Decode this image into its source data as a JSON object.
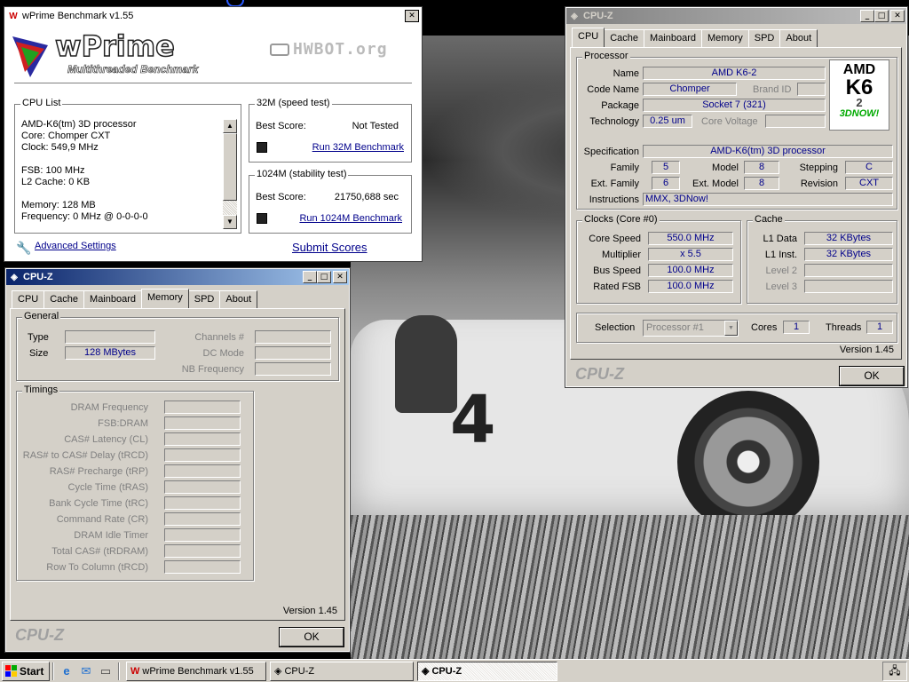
{
  "wprime": {
    "title": "wPrime Benchmark v1.55",
    "logo_text": "wPrime",
    "logo_sub": "Multithreaded Benchmark",
    "hwbot": "HWBOT.org",
    "cpu_list_label": "CPU List",
    "cpu_lines": [
      "AMD-K6(tm) 3D processor",
      "Core: Chomper CXT",
      "Clock: 549,9 MHz",
      "",
      "FSB: 100 MHz",
      "L2 Cache: 0 KB",
      "",
      "Memory: 128 MB",
      "Frequency: 0 MHz @ 0-0-0-0"
    ],
    "test32_label": "32M (speed test)",
    "best_score_label": "Best Score:",
    "score32": "Not Tested",
    "run32": "Run 32M Benchmark",
    "test1024_label": "1024M (stability test)",
    "score1024": "21750,688 sec",
    "run1024": "Run 1024M Benchmark",
    "advanced": "Advanced Settings",
    "submit": "Submit Scores"
  },
  "cpuz_mem": {
    "title": "CPU-Z",
    "tabs": [
      "CPU",
      "Cache",
      "Mainboard",
      "Memory",
      "SPD",
      "About"
    ],
    "selected_tab": "Memory",
    "general_label": "General",
    "type_label": "Type",
    "type_value": "",
    "size_label": "Size",
    "size_value": "128 MBytes",
    "channels_label": "Channels #",
    "dcmode_label": "DC Mode",
    "nbfreq_label": "NB Frequency",
    "timings_label": "Timings",
    "timings": [
      "DRAM Frequency",
      "FSB:DRAM",
      "CAS# Latency (CL)",
      "RAS# to CAS# Delay (tRCD)",
      "RAS# Precharge (tRP)",
      "Cycle Time (tRAS)",
      "Bank Cycle Time (tRC)",
      "Command Rate (CR)",
      "DRAM Idle Timer",
      "Total CAS# (tRDRAM)",
      "Row To Column (tRCD)"
    ],
    "version": "Version 1.45",
    "brand": "CPU-Z",
    "ok": "OK"
  },
  "cpuz_cpu": {
    "title": "CPU-Z",
    "tabs": [
      "CPU",
      "Cache",
      "Mainboard",
      "Memory",
      "SPD",
      "About"
    ],
    "selected_tab": "CPU",
    "processor_label": "Processor",
    "name_label": "Name",
    "name": "AMD K6-2",
    "codename_label": "Code Name",
    "codename": "Chomper",
    "brandid_label": "Brand ID",
    "package_label": "Package",
    "package": "Socket 7 (321)",
    "technology_label": "Technology",
    "technology": "0.25 um",
    "voltage_label": "Core Voltage",
    "spec_label": "Specification",
    "spec": "AMD-K6(tm) 3D processor",
    "family_label": "Family",
    "family": "5",
    "model_label": "Model",
    "model": "8",
    "stepping_label": "Stepping",
    "stepping": "C",
    "extfamily_label": "Ext. Family",
    "extfamily": "6",
    "extmodel_label": "Ext. Model",
    "extmodel": "8",
    "revision_label": "Revision",
    "revision": "CXT",
    "instructions_label": "Instructions",
    "instructions": "MMX, 3DNow!",
    "clocks_label": "Clocks (Core #0)",
    "corespeed_label": "Core Speed",
    "corespeed": "550.0 MHz",
    "multiplier_label": "Multiplier",
    "multiplier": "x 5.5",
    "busspeed_label": "Bus Speed",
    "busspeed": "100.0 MHz",
    "ratedfsb_label": "Rated FSB",
    "ratedfsb": "100.0 MHz",
    "cache_label": "Cache",
    "l1data_label": "L1 Data",
    "l1data": "32 KBytes",
    "l1inst_label": "L1 Inst.",
    "l1inst": "32 KBytes",
    "level2_label": "Level 2",
    "level3_label": "Level 3",
    "selection_label": "Selection",
    "selection": "Processor #1",
    "cores_label": "Cores",
    "cores": "1",
    "threads_label": "Threads",
    "threads": "1",
    "version": "Version 1.45",
    "brand": "CPU-Z",
    "ok": "OK",
    "logo_amd": "AMD",
    "logo_k6": "K6",
    "logo_2": "2",
    "logo_3dnow": "3DNOW!"
  },
  "taskbar": {
    "start": "Start",
    "tasks": [
      "wPrime Benchmark v1.55",
      "CPU-Z",
      "CPU-Z"
    ]
  }
}
